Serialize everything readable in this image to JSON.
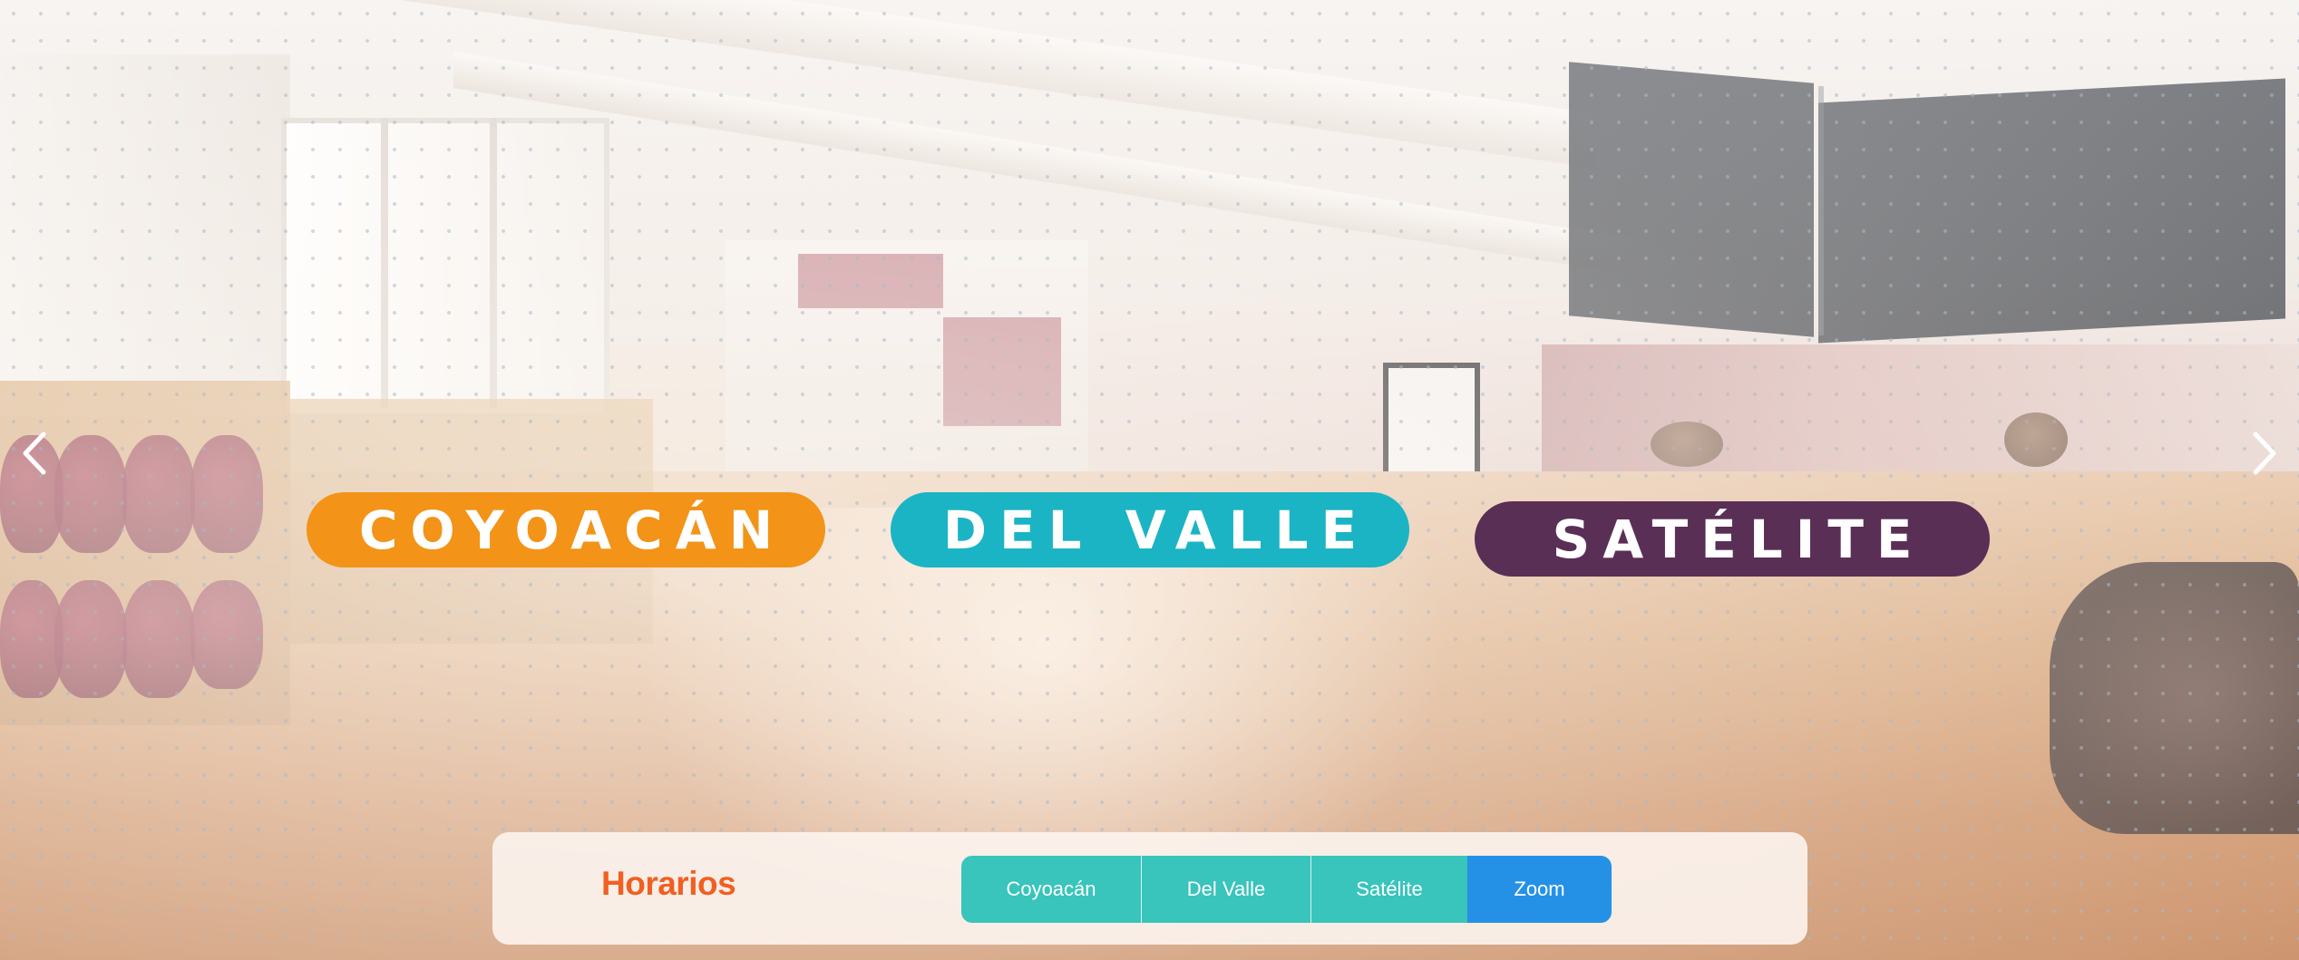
{
  "hero": {
    "locations": [
      {
        "label": "COYOACÁN",
        "color": "#f39318"
      },
      {
        "label": "DEL VALLE",
        "color": "#1bb4c4"
      },
      {
        "label": "SATÉLITE",
        "color": "#5a2f56"
      }
    ],
    "nav": {
      "prev_icon": "chevron-left-icon",
      "next_icon": "chevron-right-icon"
    }
  },
  "schedule": {
    "title": "Horarios",
    "title_color": "#f15f22",
    "tabs": [
      {
        "label": "Coyoacán",
        "color": "#39c4bc"
      },
      {
        "label": "Del Valle",
        "color": "#39c4bc"
      },
      {
        "label": "Satélite",
        "color": "#39c4bc"
      },
      {
        "label": "Zoom",
        "color": "#2491e6",
        "active": true
      }
    ]
  }
}
